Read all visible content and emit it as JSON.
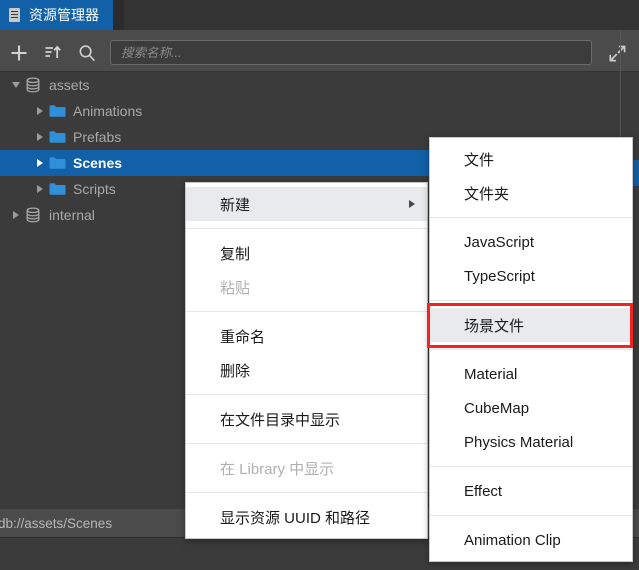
{
  "window": {
    "tab": {
      "label": "资源管理器",
      "icon": "panel-icon"
    }
  },
  "toolbar": {
    "add_icon": "plus-icon",
    "sort_icon": "sort-icon",
    "search_icon": "search-icon",
    "expand_icon": "expand-arrows-icon",
    "search": {
      "value": "",
      "placeholder": "搜索名称..."
    }
  },
  "tree": {
    "items": [
      {
        "label": "assets",
        "icon": "database-icon",
        "depth": 0,
        "expanded": true,
        "selected": false
      },
      {
        "label": "Animations",
        "icon": "folder-icon",
        "depth": 1,
        "expanded": false,
        "selected": false
      },
      {
        "label": "Prefabs",
        "icon": "folder-icon",
        "depth": 1,
        "expanded": false,
        "selected": false
      },
      {
        "label": "Scenes",
        "icon": "folder-icon",
        "depth": 1,
        "expanded": false,
        "selected": true
      },
      {
        "label": "Scripts",
        "icon": "folder-icon",
        "depth": 1,
        "expanded": false,
        "selected": false
      },
      {
        "label": "internal",
        "icon": "database-icon",
        "depth": 0,
        "expanded": false,
        "selected": false
      }
    ]
  },
  "status": {
    "path": "db://assets/Scenes"
  },
  "context_menu": {
    "items": [
      {
        "label": "新建",
        "type": "item",
        "submenu": true,
        "hover": true,
        "disabled": false
      },
      {
        "type": "separator"
      },
      {
        "label": "复制",
        "type": "item",
        "submenu": false,
        "hover": false,
        "disabled": false
      },
      {
        "label": "粘贴",
        "type": "item",
        "submenu": false,
        "hover": false,
        "disabled": true
      },
      {
        "type": "separator"
      },
      {
        "label": "重命名",
        "type": "item",
        "submenu": false,
        "hover": false,
        "disabled": false
      },
      {
        "label": "删除",
        "type": "item",
        "submenu": false,
        "hover": false,
        "disabled": false
      },
      {
        "type": "separator"
      },
      {
        "label": "在文件目录中显示",
        "type": "item",
        "submenu": false,
        "hover": false,
        "disabled": false
      },
      {
        "type": "separator"
      },
      {
        "label": "在 Library 中显示",
        "type": "item",
        "submenu": false,
        "hover": false,
        "disabled": true
      },
      {
        "type": "separator"
      },
      {
        "label": "显示资源 UUID 和路径",
        "type": "item",
        "submenu": false,
        "hover": false,
        "disabled": false
      }
    ]
  },
  "submenu": {
    "items": [
      {
        "label": "文件",
        "type": "item",
        "hover": false
      },
      {
        "label": "文件夹",
        "type": "item",
        "hover": false
      },
      {
        "type": "separator"
      },
      {
        "label": "JavaScript",
        "type": "item",
        "hover": false
      },
      {
        "label": "TypeScript",
        "type": "item",
        "hover": false
      },
      {
        "type": "separator"
      },
      {
        "label": "场景文件",
        "type": "item",
        "hover": true
      },
      {
        "type": "separator"
      },
      {
        "label": "Material",
        "type": "item",
        "hover": false
      },
      {
        "label": "CubeMap",
        "type": "item",
        "hover": false
      },
      {
        "label": "Physics Material",
        "type": "item",
        "hover": false
      },
      {
        "type": "separator"
      },
      {
        "label": "Effect",
        "type": "item",
        "hover": false
      },
      {
        "type": "separator"
      },
      {
        "label": "Animation Clip",
        "type": "item",
        "hover": false
      }
    ]
  },
  "annotation": {
    "highlight_color": "#f4231f",
    "target": "场景文件"
  },
  "colors": {
    "accent": "#1160a8",
    "panel_bg": "#3b3b3b",
    "toolbar_bg": "#4b4b4b",
    "folder": "#2f8fd8",
    "menu_bg": "#ffffff"
  }
}
